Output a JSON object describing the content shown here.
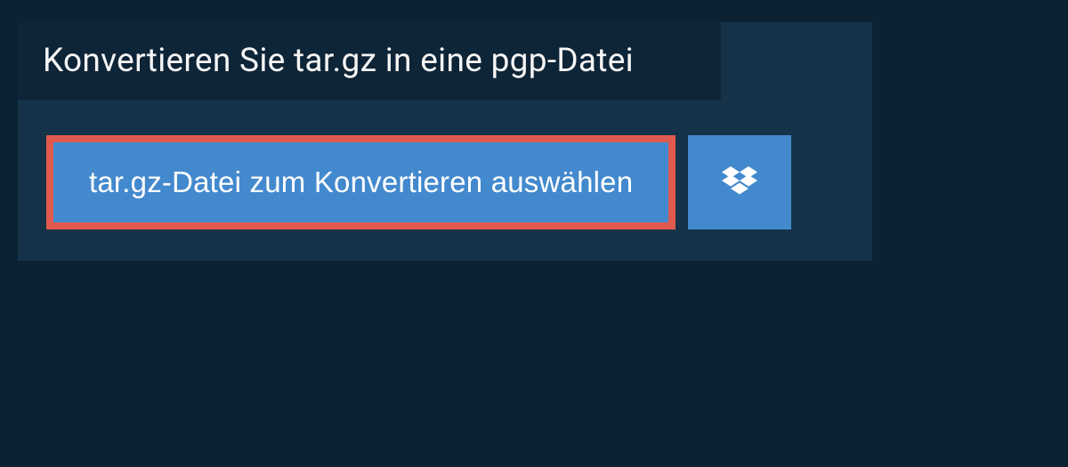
{
  "header": {
    "title": "Konvertieren Sie tar.gz in eine pgp-Datei"
  },
  "actions": {
    "select_file_label": "tar.gz-Datei zum Konvertieren auswählen"
  },
  "colors": {
    "bg": "#0c2232",
    "panel": "#153249",
    "title_bg": "#0e2437",
    "button": "#4389cd",
    "highlight_border": "#e15a4f",
    "text": "#ffffff"
  }
}
